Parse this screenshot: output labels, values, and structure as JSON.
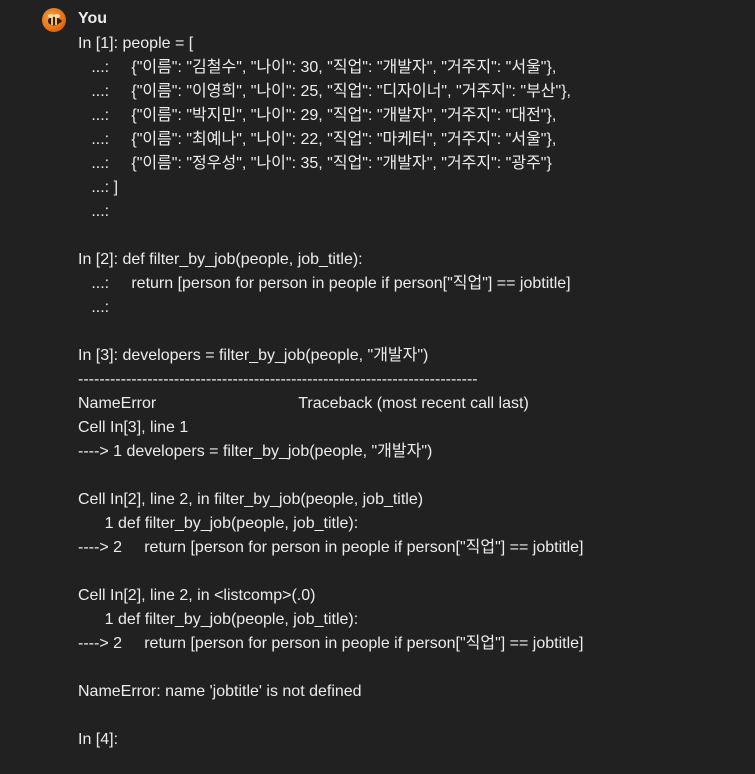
{
  "author": "You",
  "avatar_icon": "bee-avatar-icon",
  "lines": [
    "In [1]: people = [",
    "   ...:     {\"이름\": \"김철수\", \"나이\": 30, \"직업\": \"개발자\", \"거주지\": \"서울\"},",
    "   ...:     {\"이름\": \"이영희\", \"나이\": 25, \"직업\": \"디자이너\", \"거주지\": \"부산\"},",
    "   ...:     {\"이름\": \"박지민\", \"나이\": 29, \"직업\": \"개발자\", \"거주지\": \"대전\"},",
    "   ...:     {\"이름\": \"최예나\", \"나이\": 22, \"직업\": \"마케터\", \"거주지\": \"서울\"},",
    "   ...:     {\"이름\": \"정우성\", \"나이\": 35, \"직업\": \"개발자\", \"거주지\": \"광주\"}",
    "   ...: ]",
    "   ...:",
    "",
    "In [2]: def filter_by_job(people, job_title):",
    "   ...:     return [person for person in people if person[\"직업\"] == jobtitle]",
    "   ...:",
    "",
    "In [3]: developers = filter_by_job(people, \"개발자\")",
    "---------------------------------------------------------------------------",
    "NameError                                Traceback (most recent call last)",
    "Cell In[3], line 1",
    "----> 1 developers = filter_by_job(people, \"개발자\")",
    "",
    "Cell In[2], line 2, in filter_by_job(people, job_title)",
    "      1 def filter_by_job(people, job_title):",
    "----> 2     return [person for person in people if person[\"직업\"] == jobtitle]",
    "",
    "Cell In[2], line 2, in <listcomp>(.0)",
    "      1 def filter_by_job(people, job_title):",
    "----> 2     return [person for person in people if person[\"직업\"] == jobtitle]",
    "",
    "NameError: name 'jobtitle' is not defined",
    "",
    "In [4]:"
  ]
}
